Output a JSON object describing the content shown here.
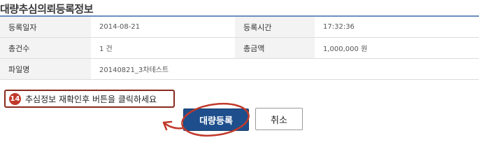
{
  "page": {
    "title": "대량추심의뢰등록정보"
  },
  "table": {
    "rows": [
      {
        "label1": "등록일자",
        "value1": "2014-08-21",
        "label2": "등록시간",
        "value2": "17:32:36"
      },
      {
        "label1": "총건수",
        "value1": "1 건",
        "label2": "총금액",
        "value2": "1,000,000 원"
      },
      {
        "label1": "파일명",
        "value1": "20140821_3차테스트"
      }
    ]
  },
  "callout": {
    "step": "14",
    "text": "추심정보 재확인후 버튼을 클릭하세요"
  },
  "buttons": {
    "submit_label": "대량등록",
    "cancel_label": "취소"
  },
  "colors": {
    "accent_blue": "#1e4f8c",
    "annotation_red": "#c0392b"
  }
}
